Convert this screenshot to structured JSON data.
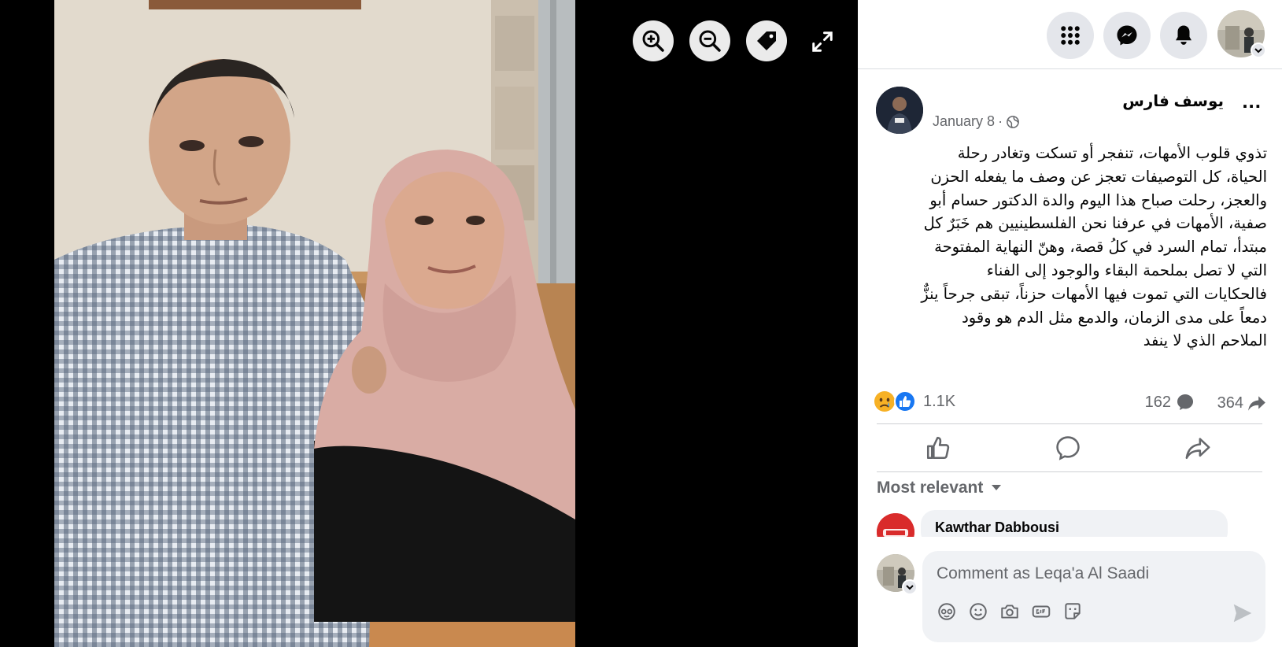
{
  "viewer": {
    "zoom_in_icon": "zoom-in-icon",
    "zoom_out_icon": "zoom-out-icon",
    "tag_icon": "tag-icon",
    "fullscreen_icon": "fullscreen-icon"
  },
  "topbar": {
    "icons": [
      "menu-grid-icon",
      "messenger-icon",
      "bell-icon",
      "profile-avatar"
    ]
  },
  "post": {
    "author": "يوسف فارس",
    "menu": "...",
    "date": "January 8",
    "separator": "·",
    "text_lines": [
      "تذوي قلوب الأمهات، تنفجر أو تسكت وتغادر رحلة",
      "الحياة، كل التوصيفات تعجز عن وصف ما يفعله الحزن",
      "والعجز، رحلت صباح هذا اليوم والدة الدكتور حسام أبو",
      "صفية، الأمهات في عرفنا نحن الفلسطينيين هم خَبَرٌ كل",
      "مبتدأ، تمام السرد في كلُ قصة، وهنّ النهاية المفتوحة",
      "التي لا تصل بملحمة البقاء والوجود إلى الفناء",
      "فالحكايات التي تموت فيها الأمهات حزناً، تبقى جرحاً ينزٌّ",
      "دمعاً على مدى الزمان، والدمع مثل الدم هو وقود",
      "الملاحم الذي لا ينفد"
    ],
    "reaction_count": "1.1K",
    "comment_count": "162",
    "share_count": "364"
  },
  "comments": {
    "sort_label": "Most relevant",
    "preview_name": "Kawthar Dabbousi",
    "composer_placeholder": "Comment as Leqa'a Al Saadi"
  },
  "colors": {
    "fb_blue": "#1877f2",
    "secondary_text": "#65676b",
    "bubble_bg": "#f0f2f5",
    "icon_bg": "#e4e6eb"
  }
}
